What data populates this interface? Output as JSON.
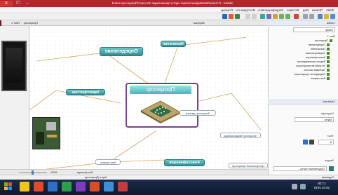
{
  "window": {
    "title": "XMind - C:\\Users\\Desktop\\интеллект карты презентация 10 класс\\Процессор.xmind",
    "buttons": {
      "min": "–",
      "max": "❐",
      "close": "✕"
    }
  },
  "menu": [
    "Файл",
    "Правка",
    "Вид",
    "Вставка",
    "Модифицировать",
    "Инструменты",
    "Помощь"
  ],
  "tabs": {
    "active": "Процессор",
    "other": "Лист 1",
    "zoom": "Загрузка"
  },
  "outline": {
    "header": "Схема",
    "search_placeholder": "Обзор",
    "items": [
      "Лист 1",
      "Процессор",
      "Определение",
      "Назначение",
      "Характеристика",
      "Классификация",
      "Фирмы производители",
      "Устройство процессора",
      "Тактовая частота",
      "Разрядность процессора",
      "Кэш-память"
    ]
  },
  "properties": {
    "header": "Свойства",
    "section_structure": "Структура",
    "structure_value": "Карта",
    "section_text": "Текст",
    "font_size": "8",
    "section_shape": "Фигура",
    "shape_value": "Округлённые черты..."
  },
  "map": {
    "central": "Процессор",
    "topics": {
      "top_left": "Назначение",
      "top_right": "Определение",
      "left": "Характеристика",
      "bottom": "Классификация"
    },
    "leaves": {
      "right_mid": "Процессор данных",
      "right_far": "Процессор ввода-вывода",
      "bottom_left": "Кэш-память",
      "bottom_right": "Центральный процессор"
    }
  },
  "bottom_bar": {
    "label": "Без фильтра",
    "zoom": "100%",
    "zoom_value": 0.5
  },
  "status": {
    "left": "Карта (Процессор)",
    "right": "Подсказки"
  },
  "taskbar": {
    "time": "17:38",
    "date": "18.04.2016"
  }
}
